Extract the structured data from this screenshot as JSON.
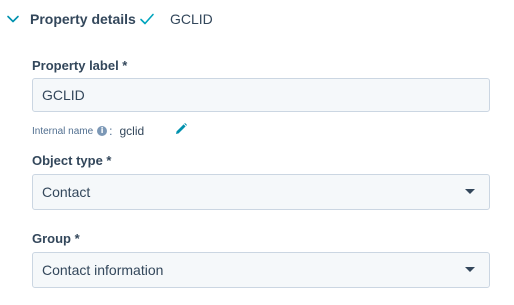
{
  "section": {
    "title": "Property details",
    "value": "GCLID",
    "collapse_icon": "chevron-down-icon",
    "status_icon": "checkmark-icon"
  },
  "property_label": {
    "label": "Property label *",
    "value": "GCLID"
  },
  "internal_name": {
    "label": "Internal name",
    "info_glyph": "i",
    "colon": ":",
    "value": "gclid",
    "edit_icon": "pencil-icon"
  },
  "object_type": {
    "label": "Object type *",
    "selected": "Contact"
  },
  "group": {
    "label": "Group *",
    "selected": "Contact information"
  },
  "colors": {
    "text": "#33475b",
    "accent": "#0091ae",
    "input_bg": "#f5f8fa",
    "input_border": "#cbd6e2"
  }
}
